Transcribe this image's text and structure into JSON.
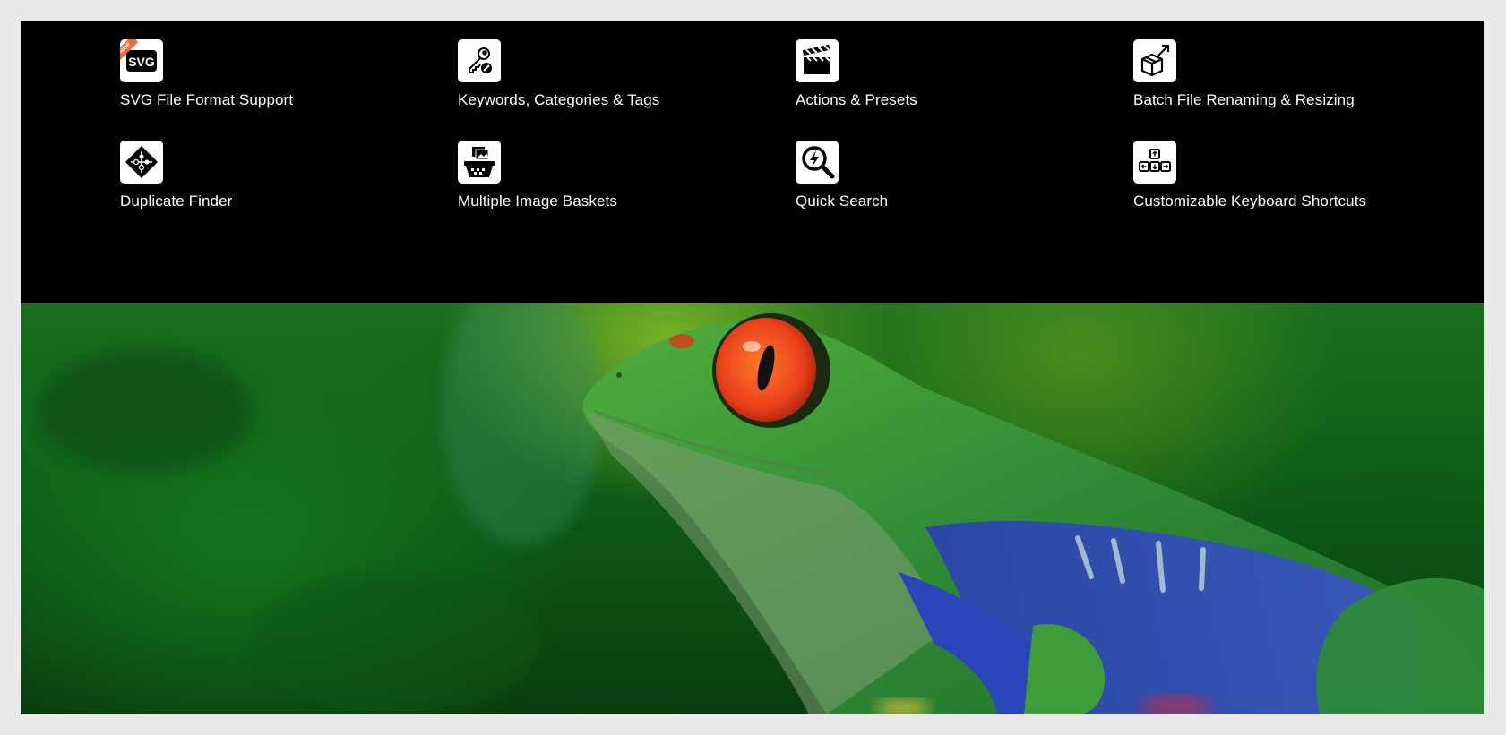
{
  "features": [
    {
      "label": "SVG File Format Support",
      "icon": "svg-file-icon",
      "badge": "NEW",
      "icon_text": "SVG"
    },
    {
      "label": "Keywords, Categories & Tags",
      "icon": "key-tag-icon"
    },
    {
      "label": "Actions & Presets",
      "icon": "clapperboard-icon"
    },
    {
      "label": "Batch File Renaming & Resizing",
      "icon": "box-export-icon"
    },
    {
      "label": "Duplicate Finder",
      "icon": "puzzle-diamond-icon"
    },
    {
      "label": "Multiple Image Baskets",
      "icon": "image-basket-icon"
    },
    {
      "label": "Quick Search",
      "icon": "lightning-search-icon"
    },
    {
      "label": "Customizable Keyboard Shortcuts",
      "icon": "keyboard-keys-icon"
    }
  ],
  "hero": {
    "subject": "red-eyed tree frog photo"
  },
  "colors": {
    "background": "#e9e9e9",
    "panel": "#000000",
    "badge": "#f06b3a",
    "text": "#ffffff"
  }
}
